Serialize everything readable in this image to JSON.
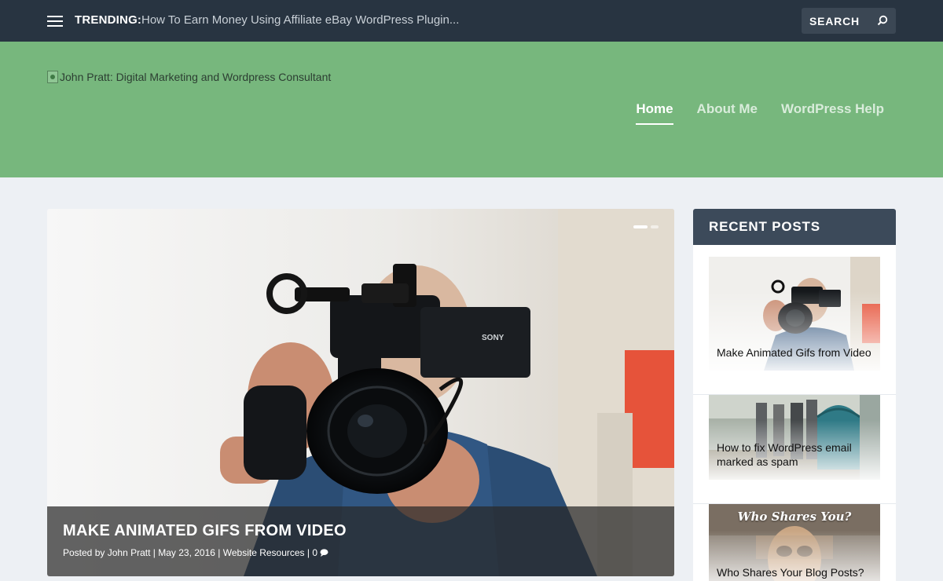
{
  "topbar": {
    "trending_label": "TRENDING:",
    "trending_link": "How To Earn Money Using Affiliate eBay WordPress Plugin...",
    "search_placeholder": "SEARCH",
    "bg_color": "#283441"
  },
  "header": {
    "logo_alt": "John Pratt: Digital Marketing and Wordpress Consultant",
    "bg_color": "#77b77d",
    "nav": [
      {
        "label": "Home",
        "active": true
      },
      {
        "label": "About Me",
        "active": false
      },
      {
        "label": "WordPress Help",
        "active": false
      }
    ]
  },
  "featured": {
    "title": "MAKE ANIMATED GIFS FROM VIDEO",
    "posted_by_prefix": "Posted by",
    "author": "John Pratt",
    "date": "May 23, 2016",
    "category": "Website Resources",
    "comments": "0",
    "slider_dots": 2,
    "active_dot": 1,
    "camera_brand": "SONY"
  },
  "sidebar": {
    "title": "RECENT POSTS",
    "posts": [
      {
        "title": "Make Animated Gifs from Video"
      },
      {
        "title": "How to fix WordPress email marked as spam"
      },
      {
        "title": "Who Shares Your Blog Posts?",
        "image_text": "Who Shares You?"
      }
    ]
  }
}
